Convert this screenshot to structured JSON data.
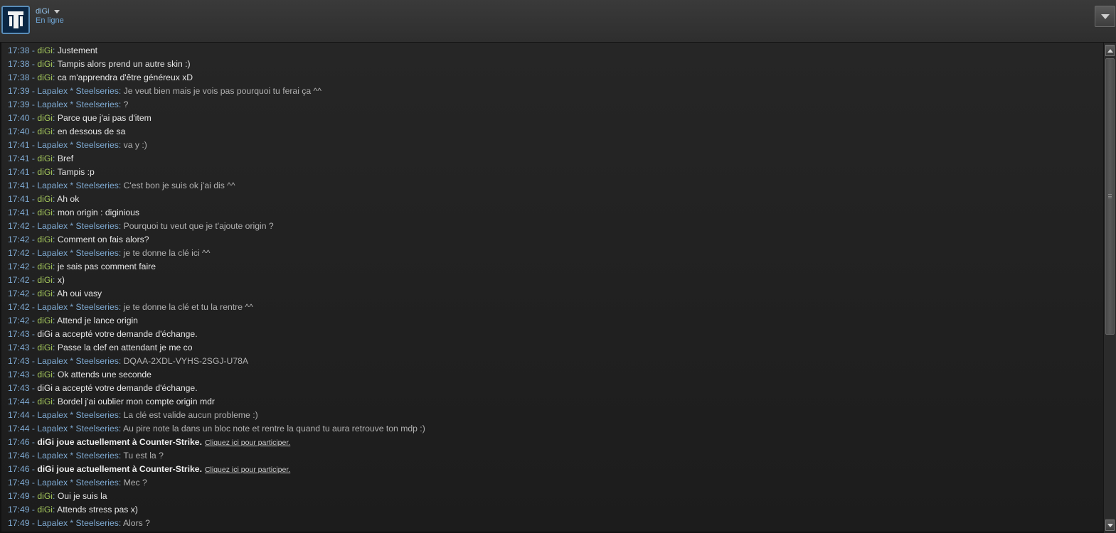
{
  "header": {
    "username": "diGi",
    "status": "En ligne"
  },
  "colors": {
    "timestamp": "#7ea9d1",
    "self_name": "#a4c75c",
    "other_name": "#7ea9d1",
    "background": "#232323"
  },
  "icons": {
    "avatar": "avatar-image",
    "user_menu": "chevron-down-icon",
    "window_menu": "dropdown-arrow-icon"
  },
  "separator": " - ",
  "messages": [
    {
      "time": "17:38",
      "kind": "me",
      "sender": "diGi",
      "text": "Justement"
    },
    {
      "time": "17:38",
      "kind": "me",
      "sender": "diGi",
      "text": "Tampis alors prend un autre skin :)"
    },
    {
      "time": "17:38",
      "kind": "me",
      "sender": "diGi",
      "text": "ca m'apprendra d'être généreux xD"
    },
    {
      "time": "17:39",
      "kind": "other",
      "sender": "Lapalex * Steelseries",
      "text": "Je veut bien mais je vois pas pourquoi tu ferai ça ^^"
    },
    {
      "time": "17:39",
      "kind": "other",
      "sender": "Lapalex * Steelseries",
      "text": "?"
    },
    {
      "time": "17:40",
      "kind": "me",
      "sender": "diGi",
      "text": "Parce que j'ai pas d'item"
    },
    {
      "time": "17:40",
      "kind": "me",
      "sender": "diGi",
      "text": "en dessous de sa"
    },
    {
      "time": "17:41",
      "kind": "other",
      "sender": "Lapalex * Steelseries",
      "text": "va y :)"
    },
    {
      "time": "17:41",
      "kind": "me",
      "sender": "diGi",
      "text": "Bref"
    },
    {
      "time": "17:41",
      "kind": "me",
      "sender": "diGi",
      "text": "Tampis :p"
    },
    {
      "time": "17:41",
      "kind": "other",
      "sender": "Lapalex * Steelseries",
      "text": "C'est bon je suis ok j'ai dis ^^"
    },
    {
      "time": "17:41",
      "kind": "me",
      "sender": "diGi",
      "text": "Ah ok"
    },
    {
      "time": "17:41",
      "kind": "me",
      "sender": "diGi",
      "text": "mon origin : diginious"
    },
    {
      "time": "17:42",
      "kind": "other",
      "sender": "Lapalex * Steelseries",
      "text": "Pourquoi tu veut que je t'ajoute origin ?"
    },
    {
      "time": "17:42",
      "kind": "me",
      "sender": "diGi",
      "text": "Comment on fais alors?"
    },
    {
      "time": "17:42",
      "kind": "other",
      "sender": "Lapalex * Steelseries",
      "text": "je te donne la clé ici ^^"
    },
    {
      "time": "17:42",
      "kind": "me",
      "sender": "diGi",
      "text": "je sais pas comment faire"
    },
    {
      "time": "17:42",
      "kind": "me",
      "sender": "diGi",
      "text": "x)"
    },
    {
      "time": "17:42",
      "kind": "me",
      "sender": "diGi",
      "text": "Ah oui vasy"
    },
    {
      "time": "17:42",
      "kind": "other",
      "sender": "Lapalex * Steelseries",
      "text": "je te donne la clé et tu la rentre ^^"
    },
    {
      "time": "17:42",
      "kind": "me",
      "sender": "diGi",
      "text": "Attend je lance origin"
    },
    {
      "time": "17:43",
      "kind": "system",
      "text": "diGi a accepté votre demande d'échange."
    },
    {
      "time": "17:43",
      "kind": "me",
      "sender": "diGi",
      "text": "Passe la clef en attendant je me co"
    },
    {
      "time": "17:43",
      "kind": "other",
      "sender": "Lapalex * Steelseries",
      "text": "DQAA-2XDL-VYHS-2SGJ-U78A"
    },
    {
      "time": "17:43",
      "kind": "me",
      "sender": "diGi",
      "text": "Ok attends une seconde"
    },
    {
      "time": "17:43",
      "kind": "system",
      "text": "diGi a accepté votre demande d'échange."
    },
    {
      "time": "17:44",
      "kind": "me",
      "sender": "diGi",
      "text": "Bordel j'ai oublier mon compte origin mdr"
    },
    {
      "time": "17:44",
      "kind": "other",
      "sender": "Lapalex * Steelseries",
      "text": "La clé est valide aucun probleme :)"
    },
    {
      "time": "17:44",
      "kind": "other",
      "sender": "Lapalex * Steelseries",
      "text": "Au pire note la dans un bloc note et rentre la quand tu aura retrouve ton mdp :)"
    },
    {
      "time": "17:46",
      "kind": "game",
      "text": "diGi joue actuellement à Counter-Strike.",
      "link": "Cliquez ici pour participer."
    },
    {
      "time": "17:46",
      "kind": "other",
      "sender": "Lapalex * Steelseries",
      "text": "Tu est la ?"
    },
    {
      "time": "17:46",
      "kind": "game",
      "text": "diGi joue actuellement à Counter-Strike.",
      "link": "Cliquez ici pour participer."
    },
    {
      "time": "17:49",
      "kind": "other",
      "sender": "Lapalex * Steelseries",
      "text": "Mec ?"
    },
    {
      "time": "17:49",
      "kind": "me",
      "sender": "diGi",
      "text": "Oui je suis la"
    },
    {
      "time": "17:49",
      "kind": "me",
      "sender": "diGi",
      "text": "Attends stress pas x)"
    },
    {
      "time": "17:49",
      "kind": "other",
      "sender": "Lapalex * Steelseries",
      "text": "Alors ?"
    }
  ]
}
